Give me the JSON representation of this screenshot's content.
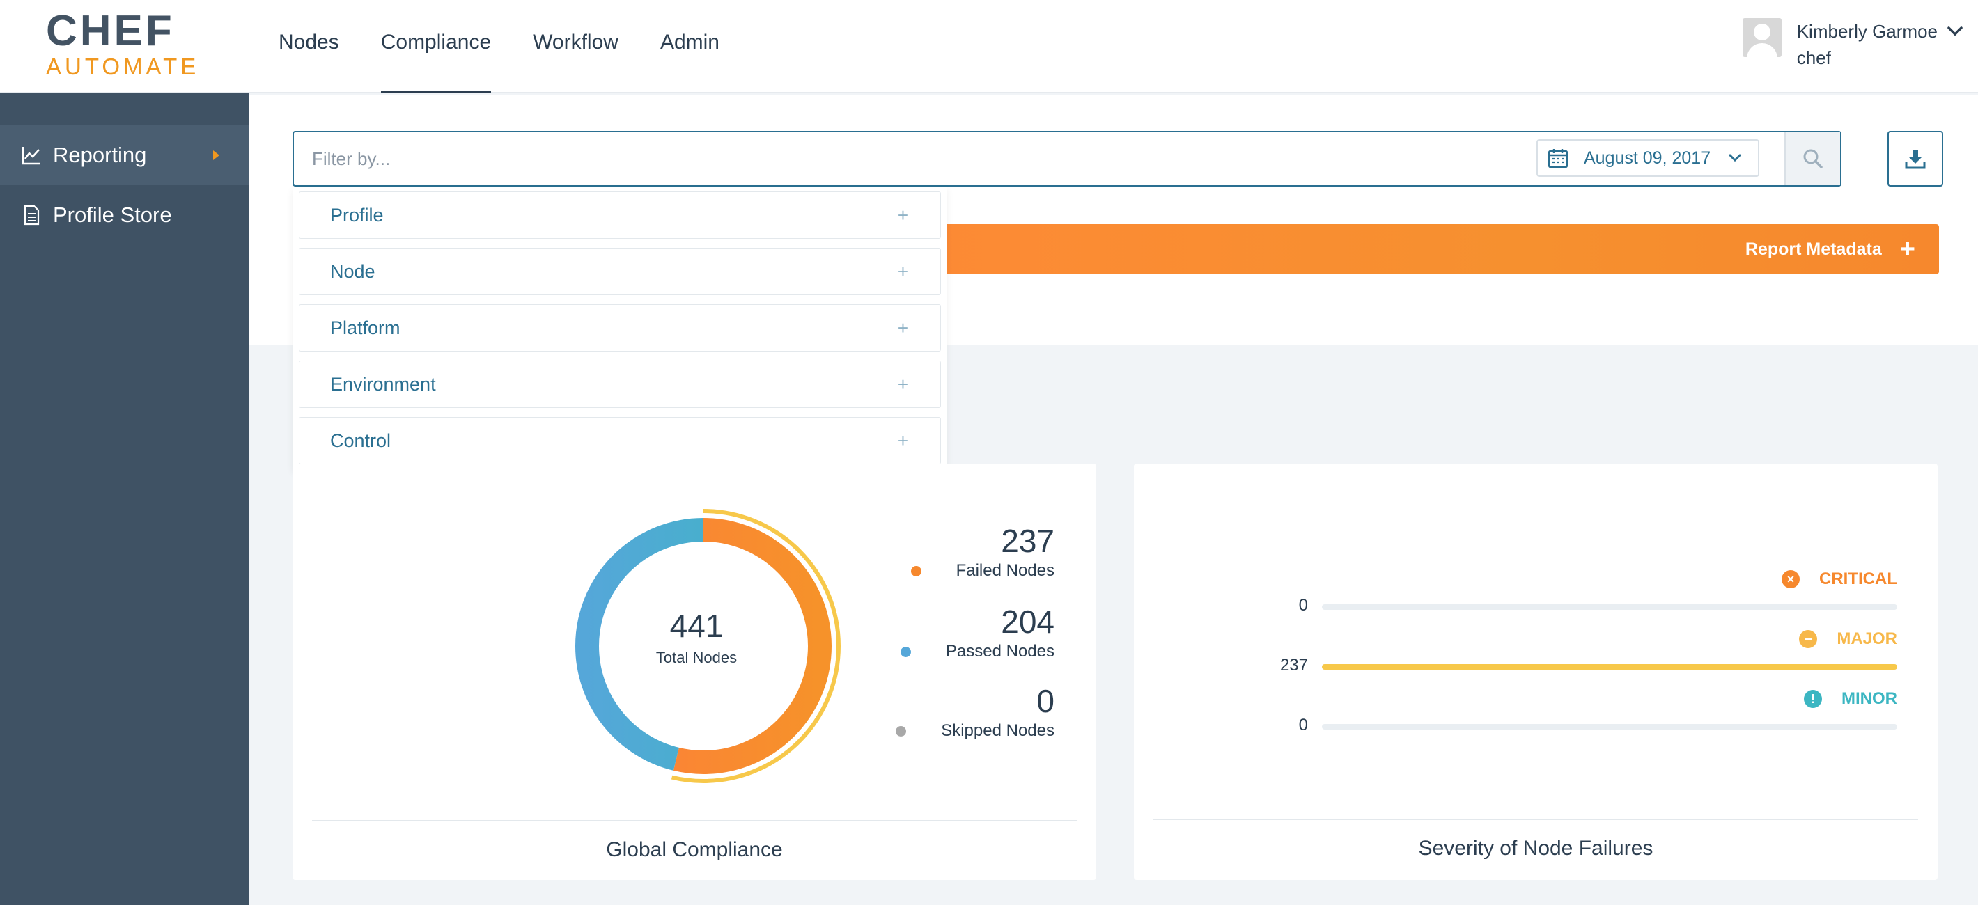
{
  "brand": {
    "line1": "CHEF",
    "line2": "AUTOMATE"
  },
  "nav": [
    {
      "label": "Nodes"
    },
    {
      "label": "Compliance"
    },
    {
      "label": "Workflow"
    },
    {
      "label": "Admin"
    }
  ],
  "user": {
    "name": "Kimberly Garmoe",
    "org": "chef"
  },
  "sidebar": {
    "items": [
      {
        "label": "Reporting",
        "icon": "chart-line-icon"
      },
      {
        "label": "Profile Store",
        "icon": "document-icon"
      }
    ]
  },
  "search": {
    "placeholder": "Filter by...",
    "value": "",
    "date": "August 09, 2017"
  },
  "metadata": {
    "label": "Report Metadata"
  },
  "filters": [
    {
      "label": "Profile"
    },
    {
      "label": "Node"
    },
    {
      "label": "Platform"
    },
    {
      "label": "Environment"
    },
    {
      "label": "Control"
    }
  ],
  "colors": {
    "accent": "#2a6f91",
    "failed": "#f6882d",
    "passed": "#55a7d9",
    "skipped": "#a8a8a8",
    "critical": "#f6882d",
    "major": "#f7b84a",
    "minor": "#3cb6c2",
    "sidebar": "#3f5264"
  },
  "compliance": {
    "title": "Global Compliance",
    "total": "441",
    "total_label": "Total Nodes",
    "failed": {
      "value": "237",
      "label": "Failed Nodes"
    },
    "passed": {
      "value": "204",
      "label": "Passed Nodes"
    },
    "skipped": {
      "value": "0",
      "label": "Skipped Nodes"
    }
  },
  "severity": {
    "title": "Severity of Node Failures",
    "critical": {
      "label": "CRITICAL",
      "value": "0"
    },
    "major": {
      "label": "MAJOR",
      "value": "237"
    },
    "minor": {
      "label": "MINOR",
      "value": "0"
    },
    "max": 237
  }
}
